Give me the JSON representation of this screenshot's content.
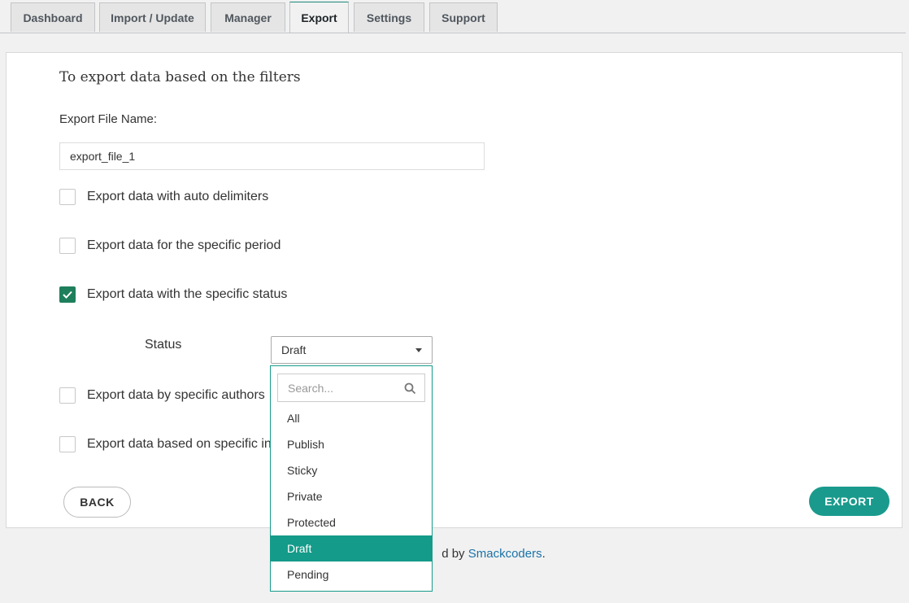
{
  "tabs": [
    {
      "label": "Dashboard"
    },
    {
      "label": "Import / Update"
    },
    {
      "label": "Manager"
    },
    {
      "label": "Export"
    },
    {
      "label": "Settings"
    },
    {
      "label": "Support"
    }
  ],
  "active_tab": "Export",
  "card": {
    "heading": "To export data based on the filters",
    "file_name_label": "Export File Name:",
    "file_name_value": "export_file_1",
    "options": [
      {
        "label": "Export data with auto delimiters",
        "checked": false
      },
      {
        "label": "Export data for the specific period",
        "checked": false
      },
      {
        "label": "Export data with the specific status",
        "checked": true
      },
      {
        "label": "Export data by specific authors",
        "checked": false
      },
      {
        "label": "Export data based on specific in",
        "checked": false
      }
    ],
    "status": {
      "label": "Status",
      "selected": "Draft"
    },
    "back_label": "BACK",
    "export_label": "EXPORT"
  },
  "footer": {
    "text_before": "d by ",
    "link": "Smackcoders",
    "text_after": "."
  },
  "dropdown": {
    "search_placeholder": "Search...",
    "options": [
      "All",
      "Publish",
      "Sticky",
      "Private",
      "Protected",
      "Draft",
      "Pending"
    ],
    "selected": "Draft"
  },
  "colors": {
    "accent": "#199a8c",
    "checkbox_checked": "#1e7f5c",
    "link": "#1a73a8"
  }
}
